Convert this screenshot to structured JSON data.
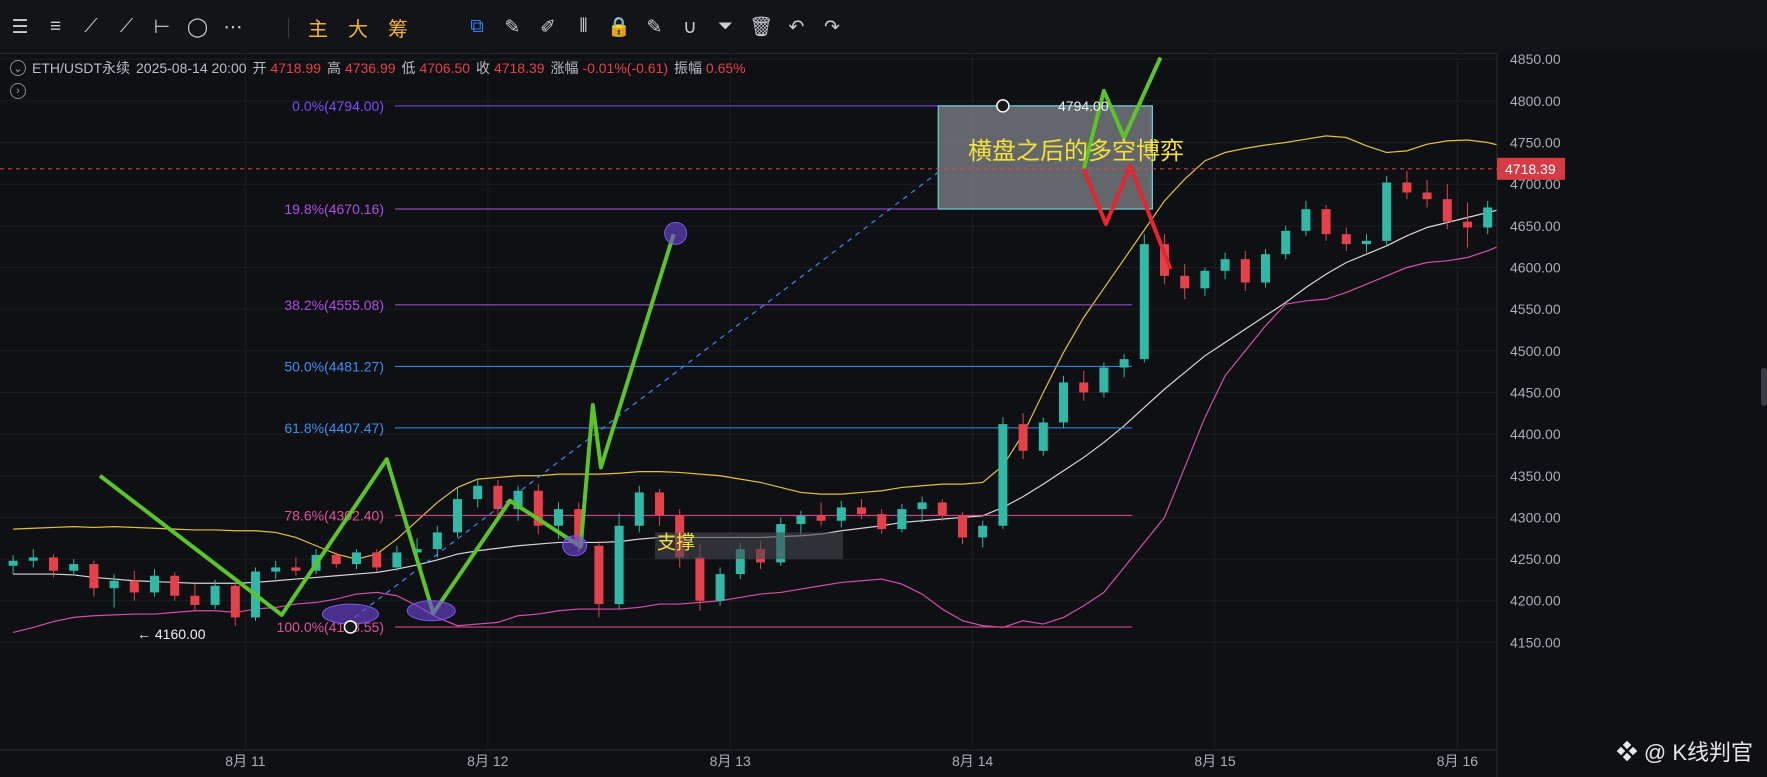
{
  "toolbar": {
    "tools": [
      {
        "name": "menu-icon",
        "glyph": "☰"
      },
      {
        "name": "horizontal-lines-icon",
        "glyph": "≡"
      },
      {
        "name": "trend-line-icon",
        "glyph": "⟋"
      },
      {
        "name": "ray-line-icon",
        "glyph": "⟋"
      },
      {
        "name": "horizontal-ray-icon",
        "glyph": "⊢"
      },
      {
        "name": "ellipse-icon",
        "glyph": "◯"
      },
      {
        "name": "more-icon",
        "glyph": "⋯"
      }
    ],
    "main_label": "主",
    "big_label": "大",
    "chip_label": "筹",
    "tools2": [
      {
        "name": "measure-icon",
        "glyph": "⧉"
      },
      {
        "name": "brush-icon",
        "glyph": "✎"
      },
      {
        "name": "pen-icon",
        "glyph": "✐"
      },
      {
        "name": "candle-tool-icon",
        "glyph": "⫴"
      },
      {
        "name": "lock-icon",
        "glyph": "🔒"
      },
      {
        "name": "note-icon",
        "glyph": "✎"
      },
      {
        "name": "magnet-icon",
        "glyph": "∪"
      },
      {
        "name": "filter-icon",
        "glyph": "⏷"
      },
      {
        "name": "trash-icon",
        "glyph": "🗑"
      },
      {
        "name": "undo-icon",
        "glyph": "↶"
      },
      {
        "name": "redo-icon",
        "glyph": "↷"
      }
    ]
  },
  "info": {
    "symbol": "ETH/USDT永续",
    "datetime": "2025-08-14 20:00",
    "open_label": "开",
    "open": "4718.99",
    "high_label": "高",
    "high": "4736.99",
    "low_label": "低",
    "low": "4706.50",
    "close_label": "收",
    "close": "4718.39",
    "change_label": "涨幅",
    "change": "-0.01%(-0.61)",
    "amp_label": "振幅",
    "amp": "0.65%"
  },
  "watermark": "@ K线判官",
  "chart_data": {
    "type": "candlestick",
    "symbol": "ETH/USDT永续",
    "interval_hours": 2,
    "ylim": [
      4130,
      4860
    ],
    "y_ticks": [
      4150,
      4200,
      4250,
      4300,
      4350,
      4400,
      4450,
      4500,
      4550,
      4600,
      4650,
      4700,
      4750,
      4800,
      4850
    ],
    "y_tick_labels": [
      "4150.00",
      "4200.00",
      "4250.00",
      "4300.00",
      "4350.00",
      "4400.00",
      "4450.00",
      "4500.00",
      "4550.00",
      "4600.00",
      "4650.00",
      "4700.00",
      "4750.00",
      "4800.00",
      "4850.00"
    ],
    "x_ticks": [
      {
        "label": "8月 11",
        "t": 12
      },
      {
        "label": "8月 12",
        "t": 24
      },
      {
        "label": "8月 13",
        "t": 36
      },
      {
        "label": "8月 14",
        "t": 48
      },
      {
        "label": "8月 15",
        "t": 60
      },
      {
        "label": "8月 16",
        "t": 72
      }
    ],
    "last_price": "4718.39",
    "last_price_value": 4718.39,
    "fib_levels": [
      {
        "label": "0.0%(4794.00)",
        "price": 4794.0,
        "color": "#7b4dff"
      },
      {
        "label": "19.8%(4670.16)",
        "price": 4670.16,
        "color": "#b14ee6"
      },
      {
        "label": "38.2%(4555.08)",
        "price": 4555.08,
        "color": "#b14ee6"
      },
      {
        "label": "50.0%(4481.27)",
        "price": 4481.27,
        "color": "#3f8ef2"
      },
      {
        "label": "61.8%(4407.47)",
        "price": 4407.47,
        "color": "#3f8ef2"
      },
      {
        "label": "78.6%(4302.40)",
        "price": 4302.4,
        "color": "#e24f9c"
      },
      {
        "label": "100.0%(4168.55)",
        "price": 4168.55,
        "color": "#e24f9c"
      }
    ],
    "annotations": {
      "low_marker": "← 4160.00",
      "high_marker": "4794.00",
      "support_text": "支撑",
      "range_text": "横盘之后的多空博弈"
    },
    "candles": [
      [
        4242,
        4255,
        4232,
        4248
      ],
      [
        4248,
        4262,
        4240,
        4252
      ],
      [
        4252,
        4256,
        4228,
        4236
      ],
      [
        4236,
        4250,
        4230,
        4244
      ],
      [
        4244,
        4248,
        4205,
        4215
      ],
      [
        4215,
        4232,
        4192,
        4224
      ],
      [
        4224,
        4236,
        4200,
        4210
      ],
      [
        4210,
        4238,
        4205,
        4230
      ],
      [
        4230,
        4234,
        4200,
        4206
      ],
      [
        4206,
        4220,
        4188,
        4195
      ],
      [
        4195,
        4225,
        4190,
        4218
      ],
      [
        4218,
        4222,
        4170,
        4180
      ],
      [
        4180,
        4240,
        4176,
        4235
      ],
      [
        4235,
        4248,
        4226,
        4240
      ],
      [
        4240,
        4252,
        4230,
        4236
      ],
      [
        4236,
        4262,
        4232,
        4255
      ],
      [
        4255,
        4258,
        4240,
        4244
      ],
      [
        4244,
        4262,
        4238,
        4258
      ],
      [
        4258,
        4262,
        4235,
        4240
      ],
      [
        4240,
        4266,
        4236,
        4258
      ],
      [
        4258,
        4275,
        4248,
        4262
      ],
      [
        4262,
        4290,
        4252,
        4282
      ],
      [
        4282,
        4335,
        4276,
        4322
      ],
      [
        4322,
        4346,
        4312,
        4338
      ],
      [
        4338,
        4345,
        4300,
        4310
      ],
      [
        4310,
        4338,
        4296,
        4332
      ],
      [
        4332,
        4340,
        4280,
        4290
      ],
      [
        4290,
        4318,
        4274,
        4310
      ],
      [
        4310,
        4318,
        4258,
        4266
      ],
      [
        4266,
        4272,
        4180,
        4196
      ],
      [
        4196,
        4305,
        4190,
        4290
      ],
      [
        4290,
        4338,
        4282,
        4330
      ],
      [
        4330,
        4334,
        4290,
        4302
      ],
      [
        4302,
        4310,
        4240,
        4252
      ],
      [
        4252,
        4268,
        4188,
        4200
      ],
      [
        4200,
        4240,
        4194,
        4232
      ],
      [
        4232,
        4270,
        4226,
        4262
      ],
      [
        4262,
        4272,
        4238,
        4246
      ],
      [
        4246,
        4300,
        4242,
        4292
      ],
      [
        4292,
        4308,
        4278,
        4302
      ],
      [
        4302,
        4318,
        4290,
        4296
      ],
      [
        4296,
        4320,
        4288,
        4312
      ],
      [
        4312,
        4322,
        4298,
        4304
      ],
      [
        4304,
        4310,
        4280,
        4286
      ],
      [
        4286,
        4316,
        4282,
        4310
      ],
      [
        4310,
        4325,
        4294,
        4318
      ],
      [
        4318,
        4322,
        4296,
        4302
      ],
      [
        4302,
        4306,
        4268,
        4276
      ],
      [
        4276,
        4296,
        4264,
        4290
      ],
      [
        4290,
        4420,
        4286,
        4412
      ],
      [
        4412,
        4425,
        4370,
        4380
      ],
      [
        4380,
        4420,
        4374,
        4414
      ],
      [
        4414,
        4470,
        4408,
        4462
      ],
      [
        4462,
        4476,
        4440,
        4450
      ],
      [
        4450,
        4486,
        4444,
        4480
      ],
      [
        4480,
        4496,
        4468,
        4490
      ],
      [
        4490,
        4640,
        4486,
        4628
      ],
      [
        4628,
        4640,
        4580,
        4590
      ],
      [
        4590,
        4604,
        4562,
        4575
      ],
      [
        4575,
        4600,
        4566,
        4596
      ],
      [
        4596,
        4618,
        4586,
        4610
      ],
      [
        4610,
        4620,
        4572,
        4582
      ],
      [
        4582,
        4622,
        4576,
        4616
      ],
      [
        4616,
        4650,
        4610,
        4644
      ],
      [
        4644,
        4680,
        4638,
        4670
      ],
      [
        4670,
        4675,
        4632,
        4640
      ],
      [
        4640,
        4648,
        4620,
        4628
      ],
      [
        4628,
        4640,
        4618,
        4632
      ],
      [
        4632,
        4710,
        4626,
        4702
      ],
      [
        4702,
        4716,
        4682,
        4690
      ],
      [
        4690,
        4705,
        4672,
        4682
      ],
      [
        4682,
        4700,
        4646,
        4655
      ],
      [
        4655,
        4678,
        4624,
        4648
      ],
      [
        4648,
        4680,
        4640,
        4672
      ],
      [
        4672,
        4720,
        4666,
        4712
      ],
      [
        4712,
        4738,
        4700,
        4730
      ],
      [
        4730,
        4745,
        4708,
        4716
      ],
      [
        4716,
        4738,
        4706,
        4732
      ],
      [
        4732,
        4752,
        4722,
        4744
      ],
      [
        4744,
        4760,
        4730,
        4738
      ],
      [
        4738,
        4748,
        4700,
        4708
      ],
      [
        4708,
        4740,
        4702,
        4732
      ],
      [
        4732,
        4786,
        4726,
        4776
      ],
      [
        4776,
        4794,
        4748,
        4756
      ],
      [
        4756,
        4768,
        4718,
        4728
      ],
      [
        4728,
        4748,
        4716,
        4742
      ],
      [
        4742,
        4760,
        4690,
        4700
      ],
      [
        4700,
        4730,
        4696,
        4718
      ]
    ],
    "boll_upper": [
      4286,
      4287,
      4288,
      4289,
      4288,
      4289,
      4288,
      4287,
      4286,
      4285,
      4285,
      4284,
      4284,
      4282,
      4276,
      4266,
      4256,
      4250,
      4256,
      4274,
      4296,
      4318,
      4336,
      4346,
      4348,
      4350,
      4350,
      4352,
      4352,
      4352,
      4353,
      4355,
      4355,
      4354,
      4352,
      4350,
      4346,
      4342,
      4336,
      4330,
      4328,
      4328,
      4330,
      4332,
      4336,
      4338,
      4340,
      4340,
      4342,
      4362,
      4400,
      4450,
      4498,
      4540,
      4575,
      4610,
      4645,
      4680,
      4706,
      4728,
      4738,
      4743,
      4747,
      4750,
      4754,
      4758,
      4756,
      4746,
      4738,
      4740,
      4748,
      4752,
      4753,
      4750,
      4744,
      4740,
      4748,
      4764,
      4776,
      4785,
      4788,
      4792,
      4794,
      4796,
      4792,
      4786,
      4778,
      4772
    ],
    "boll_mid": [
      4232,
      4232,
      4232,
      4231,
      4228,
      4226,
      4224,
      4223,
      4222,
      4221,
      4221,
      4221,
      4222,
      4224,
      4226,
      4228,
      4230,
      4232,
      4234,
      4238,
      4243,
      4249,
      4256,
      4260,
      4263,
      4266,
      4268,
      4270,
      4270,
      4270,
      4271,
      4274,
      4276,
      4276,
      4276,
      4276,
      4276,
      4276,
      4277,
      4278,
      4280,
      4284,
      4287,
      4290,
      4294,
      4296,
      4298,
      4300,
      4302,
      4312,
      4325,
      4340,
      4356,
      4372,
      4390,
      4410,
      4432,
      4454,
      4474,
      4494,
      4510,
      4526,
      4542,
      4558,
      4576,
      4592,
      4606,
      4616,
      4626,
      4638,
      4648,
      4654,
      4660,
      4666,
      4672,
      4678,
      4686,
      4694,
      4702,
      4708,
      4714,
      4718,
      4722,
      4726,
      4728,
      4729,
      4730,
      4730
    ],
    "boll_lower": [
      4162,
      4168,
      4175,
      4180,
      4182,
      4183,
      4184,
      4184,
      4186,
      4188,
      4188,
      4186,
      4190,
      4192,
      4196,
      4198,
      4202,
      4208,
      4210,
      4206,
      4194,
      4180,
      4170,
      4172,
      4174,
      4182,
      4184,
      4188,
      4190,
      4190,
      4190,
      4192,
      4196,
      4196,
      4198,
      4200,
      4204,
      4208,
      4210,
      4214,
      4218,
      4222,
      4224,
      4226,
      4220,
      4208,
      4190,
      4176,
      4170,
      4168,
      4176,
      4172,
      4180,
      4194,
      4210,
      4240,
      4270,
      4300,
      4360,
      4420,
      4470,
      4500,
      4530,
      4556,
      4560,
      4562,
      4570,
      4580,
      4590,
      4600,
      4606,
      4608,
      4612,
      4620,
      4630,
      4640,
      4650,
      4654,
      4660,
      4666,
      4672,
      4680,
      4688,
      4694,
      4696,
      4700,
      4704,
      4706
    ],
    "zigzag_green": [
      [
        4.8,
        4350
      ],
      [
        13.8,
        4183
      ],
      [
        19,
        4370
      ],
      [
        21.3,
        4185
      ],
      [
        25.1,
        4320
      ],
      [
        28.6,
        4265
      ],
      [
        29.2,
        4435
      ],
      [
        29.6,
        4360
      ],
      [
        33.2,
        4640
      ]
    ],
    "projection_green": [
      [
        53.5,
        4718
      ],
      [
        54.5,
        4812
      ],
      [
        55.5,
        4756
      ],
      [
        57.3,
        4852
      ]
    ],
    "projection_red": [
      [
        53.5,
        4718
      ],
      [
        54.6,
        4652
      ],
      [
        55.8,
        4722
      ],
      [
        57.8,
        4598
      ]
    ],
    "trend_dashed": [
      [
        17.4,
        4180
      ],
      [
        46.5,
        4718
      ]
    ]
  }
}
